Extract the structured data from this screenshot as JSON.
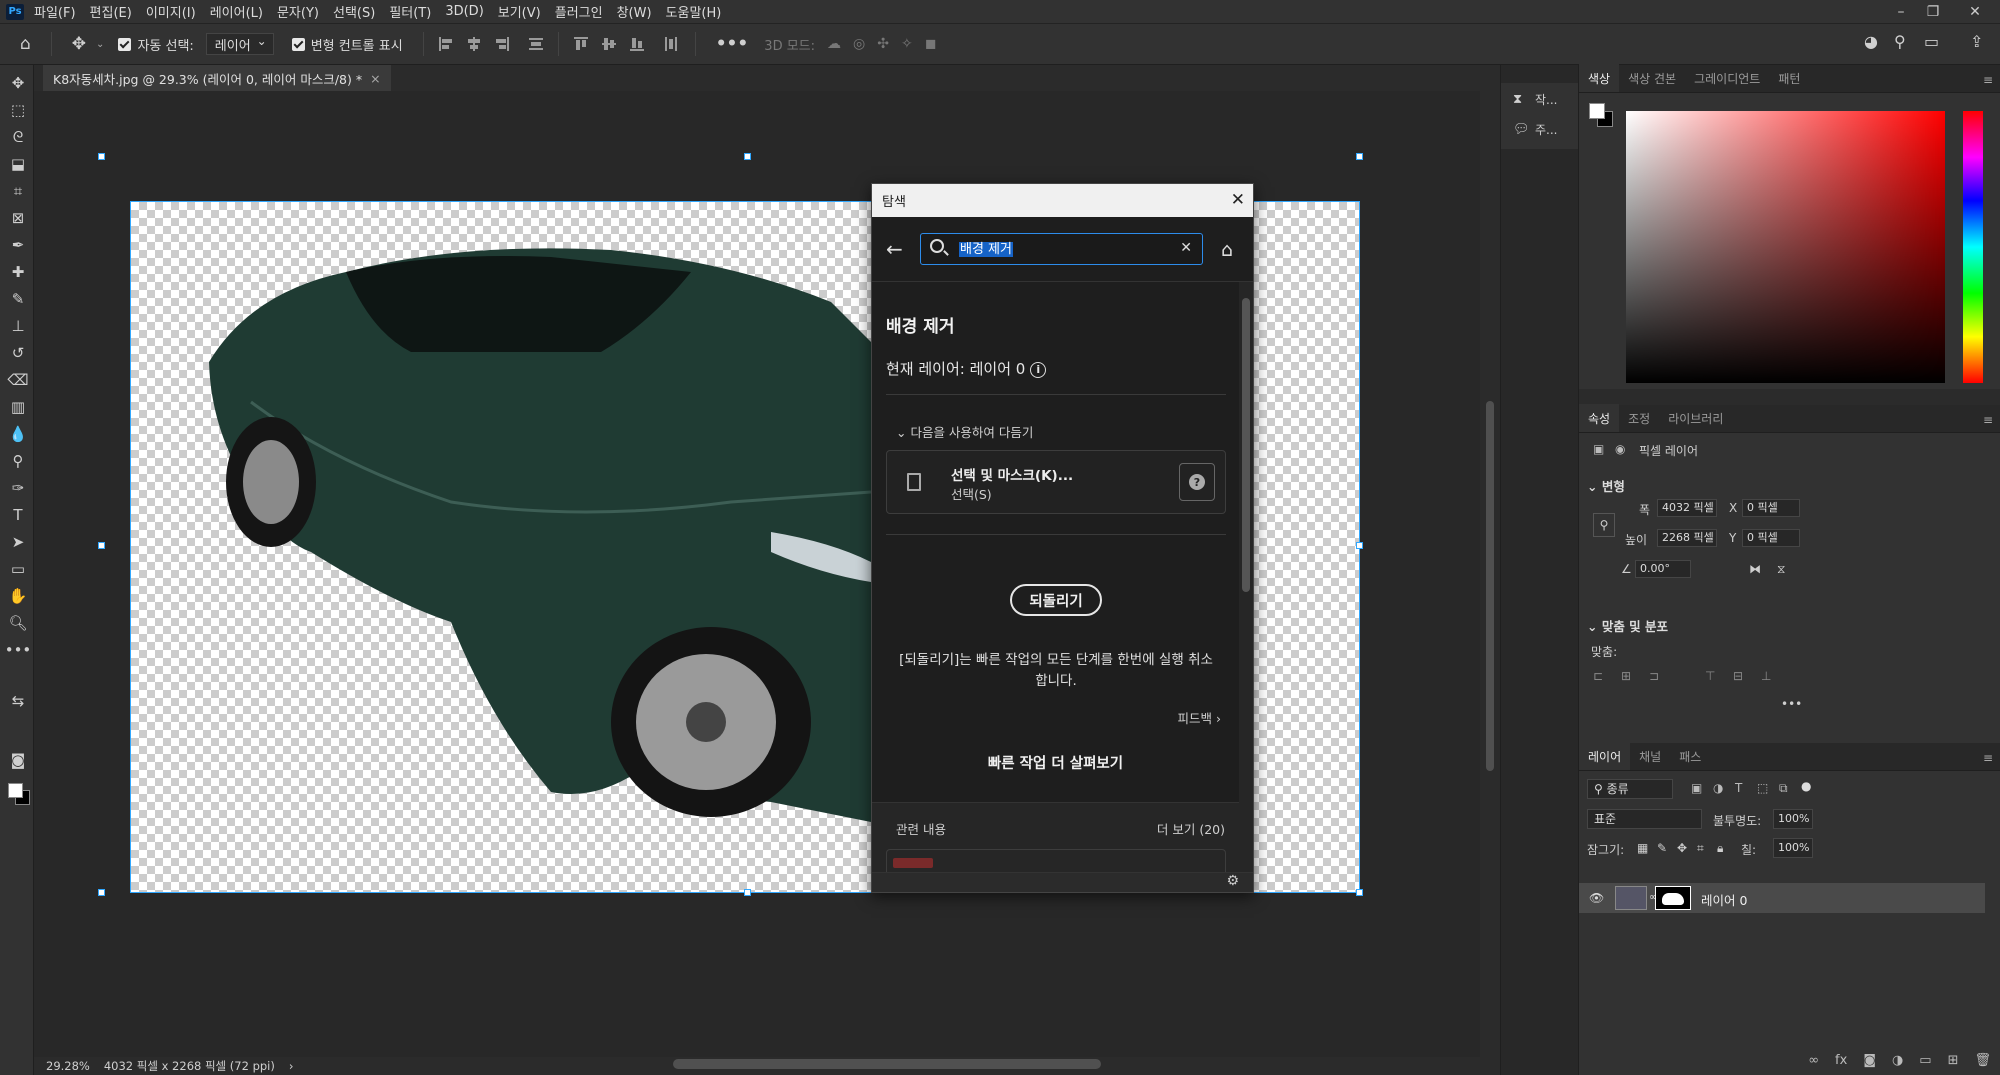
{
  "menubar": {
    "logo": "Ps",
    "items": [
      "파일(F)",
      "편집(E)",
      "이미지(I)",
      "레이어(L)",
      "문자(Y)",
      "선택(S)",
      "필터(T)",
      "3D(D)",
      "보기(V)",
      "플러그인",
      "창(W)",
      "도움말(H)"
    ]
  },
  "options": {
    "auto_select_label": "자동 선택:",
    "auto_select_value": "레이어",
    "transform_label": "변형 컨트롤 표시",
    "threed_mode_label": "3D 모드:"
  },
  "document": {
    "tab_title": "K8자동세차.jpg @ 29.3% (레이어 0, 레이어 마스크/8) *",
    "zoom": "29.28%",
    "dimensions": "4032 픽셀 x 2268 픽셀 (72 ppi)"
  },
  "discover": {
    "title": "탐색",
    "search_value": "배경 제거",
    "heading": "배경 제거",
    "current_layer": "현재 레이어: 레이어 0",
    "explore_label": "다음을 사용하여 다듬기",
    "card_title": "선택 및 마스크(K)...",
    "card_subtitle": "선택(S)",
    "revert_label": "되돌리기",
    "revert_desc_1": "[되돌리기]는 빠른 작업의 모든 단계를 한번에 실행 취소",
    "revert_desc_2": "합니다.",
    "feedback": "피드백 ›",
    "more_actions": "빠른 작업 더 살펴보기",
    "related_label": "관련 내용",
    "related_more": "더 보기 (20)"
  },
  "midcol": {
    "item1": "작...",
    "item2": "주..."
  },
  "color_panel": {
    "tabs": [
      "색상",
      "색상 견본",
      "그레이디언트",
      "패턴"
    ],
    "active_tab": "색상"
  },
  "properties": {
    "tabs": [
      "속성",
      "조정",
      "라이브러리"
    ],
    "layer_type": "픽셀 레이어",
    "transform_section": "변형",
    "width_label": "폭",
    "width_value": "4032 픽셀",
    "height_label": "높이",
    "height_value": "2268 픽셀",
    "x_label": "X",
    "x_value": "0 픽셀",
    "y_label": "Y",
    "y_value": "0 픽셀",
    "angle_value": "0.00°",
    "align_section": "맞춤 및 분포",
    "align_label": "맞춤:"
  },
  "layers": {
    "tabs": [
      "레이어",
      "채널",
      "패스"
    ],
    "filter_kind": "종류",
    "blend_mode": "표준",
    "opacity_label": "불투명도:",
    "opacity_value": "100%",
    "lock_label": "잠그기:",
    "fill_label": "칠:",
    "fill_value": "100%",
    "layer_name": "레이어 0"
  },
  "colors": {
    "accent": "#31a8ff",
    "car_body": "#1f3b33"
  }
}
